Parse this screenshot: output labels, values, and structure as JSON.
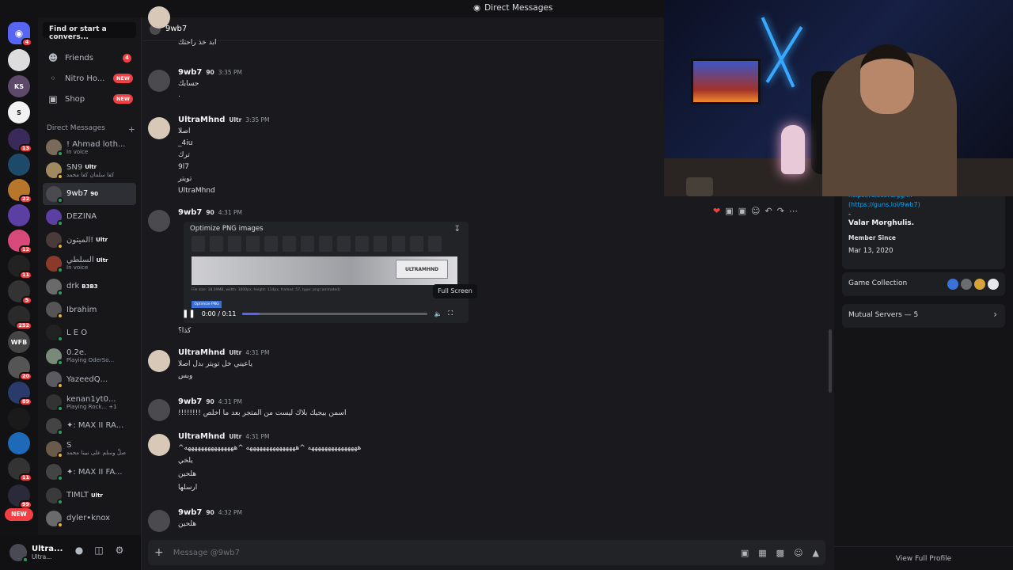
{
  "window": {
    "title": "Direct Messages"
  },
  "rail": {
    "home_badge": "4",
    "servers": [
      {
        "label": "",
        "badge": ""
      },
      {
        "label": "KS",
        "badge": ""
      },
      {
        "label": "S",
        "badge": ""
      },
      {
        "label": "",
        "badge": "13"
      },
      {
        "label": "",
        "badge": ""
      },
      {
        "label": "",
        "badge": "22"
      },
      {
        "label": "",
        "badge": ""
      },
      {
        "label": "",
        "badge": "12"
      },
      {
        "label": "",
        "badge": "11"
      },
      {
        "label": "",
        "badge": "5"
      },
      {
        "label": "",
        "badge": "252"
      },
      {
        "label": "WFB",
        "badge": ""
      },
      {
        "label": "",
        "badge": "20"
      },
      {
        "label": "",
        "badge": "89"
      },
      {
        "label": "",
        "badge": ""
      },
      {
        "label": "",
        "badge": ""
      },
      {
        "label": "",
        "badge": "11"
      },
      {
        "label": "",
        "badge": "99"
      }
    ],
    "new_label": "NEW"
  },
  "dm_sidebar": {
    "search_placeholder": "Find or start a convers...",
    "nav": [
      {
        "label": "Friends",
        "badge": "4"
      },
      {
        "label": "Nitro Ho...",
        "badge": "NEW"
      },
      {
        "label": "Shop",
        "badge": "NEW"
      }
    ],
    "header": "Direct Messages",
    "add_icon": "+",
    "dms": [
      {
        "name": "! Ahmad loth...",
        "sub": "In voice",
        "tag": "",
        "color": "#7a6a5a"
      },
      {
        "name": "SN9",
        "sub": "كفا سلمان كفا محمد",
        "tag": "Ultr",
        "color": "#a08860"
      },
      {
        "name": "9wb7",
        "sub": "",
        "tag": "90",
        "color": "#4a4a4f"
      },
      {
        "name": "DEZINA",
        "sub": "",
        "tag": "",
        "color": "#5b3fa3"
      },
      {
        "name": "الميتون!",
        "sub": "",
        "tag": "Ultr",
        "color": "#4a3a3a"
      },
      {
        "name": "السلطي",
        "sub": "In voice",
        "tag": "Ultr",
        "color": "#8a3a2a"
      },
      {
        "name": "drk",
        "sub": "",
        "tag": "B3B3",
        "color": "#6a6a6a"
      },
      {
        "name": "Ibrahim",
        "sub": "",
        "tag": "",
        "color": "#555"
      },
      {
        "name": "L E O",
        "sub": "",
        "tag": "",
        "color": "#222"
      },
      {
        "name": "0.2e.",
        "sub": "Playing OderSo...",
        "tag": "",
        "color": "#7a8a7a"
      },
      {
        "name": "YazeedQ...",
        "sub": "",
        "tag": "",
        "color": "#5a5a60"
      },
      {
        "name": "kenan1yt0...",
        "sub": "Playing Rock... +1",
        "tag": "",
        "color": "#333"
      },
      {
        "name": "✦: MAX II RA...",
        "sub": "",
        "tag": "",
        "color": "#444"
      },
      {
        "name": "S",
        "sub": "صلِّ وسلم على نبينا محمد",
        "tag": "",
        "color": "#6a5a4a"
      },
      {
        "name": "✦: MAX II FA...",
        "sub": "",
        "tag": "",
        "color": "#444"
      },
      {
        "name": "TIMLT",
        "sub": "",
        "tag": "Ultr",
        "color": "#3a3a3a"
      },
      {
        "name": "dyler•knox",
        "sub": "",
        "tag": "",
        "color": "#6a6a6a"
      }
    ]
  },
  "user_panel": {
    "name": "Ultra...",
    "status": "Ultra..."
  },
  "chat": {
    "channel_name": "9wb7",
    "messages": [
      {
        "author": "",
        "time": "",
        "badge": "",
        "lines": [
          "ابد خذ راحتك"
        ]
      },
      {
        "author": "9wb7",
        "time": "3:35 PM",
        "badge": "90",
        "lines": [
          "حسابك",
          "."
        ]
      },
      {
        "author": "UltraMhnd",
        "time": "3:35 PM",
        "badge": "Ultr",
        "lines": [
          "اصلا",
          "_4iu",
          "ترك",
          "9l7",
          "تويتر",
          "UltraMhnd"
        ]
      },
      {
        "author": "9wb7",
        "time": "4:31 PM",
        "badge": "90",
        "lines": [
          "كذا؟"
        ]
      },
      {
        "author": "UltraMhnd",
        "time": "4:31 PM",
        "badge": "Ultr",
        "lines": [
          "ياعيني خل تويتر بدل اصلا",
          "وبس"
        ]
      },
      {
        "author": "9wb7",
        "time": "4:31 PM",
        "badge": "90",
        "lines": [
          "!!!!!!!! اسمن بيجيك بلاك ليست من المتجر بعد ما اخلص"
        ]
      },
      {
        "author": "UltraMhnd",
        "time": "4:31 PM",
        "badge": "Ultr",
        "lines": [
          "^هههههههههههههههه ^هههههههههههههههه ^هههههههههههههههه",
          "يلخي",
          "هلحين",
          "ارسلها"
        ]
      },
      {
        "author": "9wb7",
        "time": "4:32 PM",
        "badge": "90",
        "lines": [
          "هلحين"
        ]
      }
    ],
    "attachment": {
      "title": "Optimize PNG images",
      "logo_text": "ULTRAMHND",
      "meta": "File size: 18.09MB, width: 1000px, height: 114px, frames: 57, type: png (animated)",
      "button": "Optimize PNG",
      "time_display": "0:00 / 0:11",
      "progress": 0.09
    },
    "tooltip": "Full Screen",
    "composer_placeholder": "Message @9wb7"
  },
  "profile": {
    "link_partial": "https://discord.gg/...",
    "link": "(https://guns.lol/9wb7)",
    "dash": "-",
    "motto": "Valar Morghulis.",
    "member_since_label": "Member Since",
    "member_since": "Mar 13, 2020",
    "game_collection": "Game Collection",
    "mutual_servers": "Mutual Servers — 5",
    "view_full": "View Full Profile"
  },
  "colors": {
    "accent": "#5865f2",
    "danger": "#f23f43",
    "online": "#23a55a",
    "link": "#00a8fc"
  }
}
